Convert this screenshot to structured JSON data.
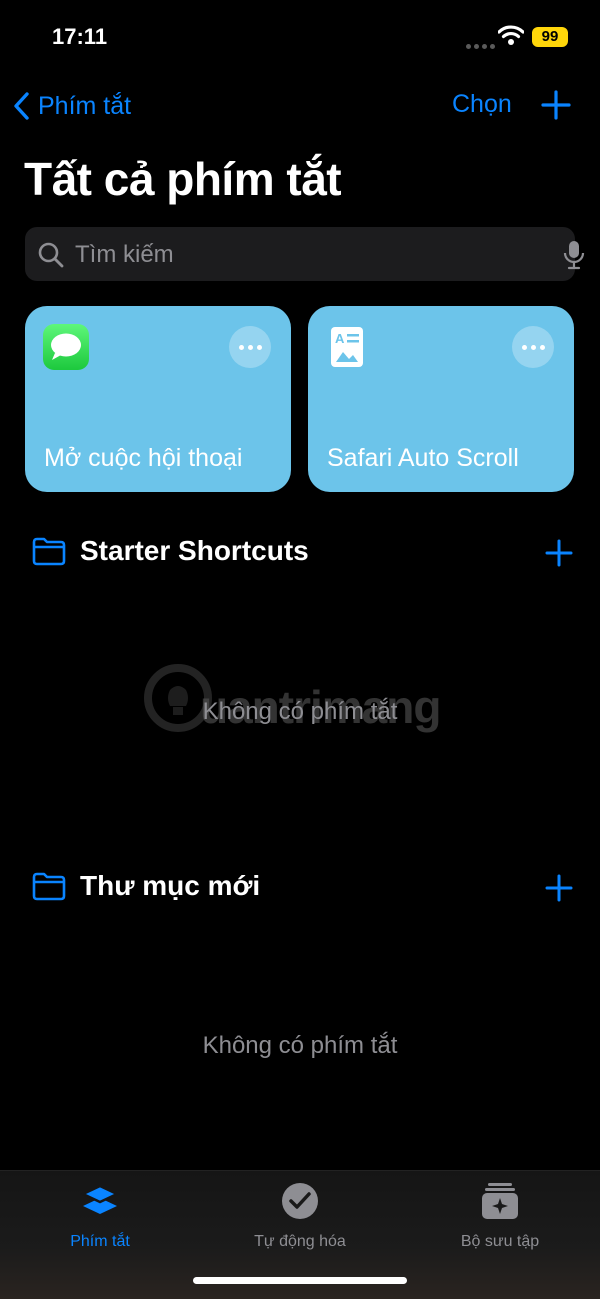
{
  "status": {
    "time": "17:11",
    "battery": "99"
  },
  "nav": {
    "back_label": "Phím tắt",
    "select_label": "Chọn"
  },
  "page_title": "Tất cả phím tắt",
  "search": {
    "placeholder": "Tìm kiếm"
  },
  "cards": [
    {
      "label": "Mở cuộc hội thoại",
      "icon": "messages-icon"
    },
    {
      "label": "Safari Auto Scroll",
      "icon": "document-icon"
    }
  ],
  "folders": [
    {
      "title": "Starter Shortcuts",
      "empty_text": "Không có phím tắt"
    },
    {
      "title": "Thư mục mới",
      "empty_text": "Không có phím tắt"
    }
  ],
  "watermark": "uantrimang",
  "tabs": [
    {
      "label": "Phím tắt",
      "active": true
    },
    {
      "label": "Tự động hóa",
      "active": false
    },
    {
      "label": "Bộ sưu tập",
      "active": false
    }
  ],
  "colors": {
    "accent": "#0a84ff",
    "card": "#6cc4ea",
    "yellow_battery": "#ffd60a"
  }
}
